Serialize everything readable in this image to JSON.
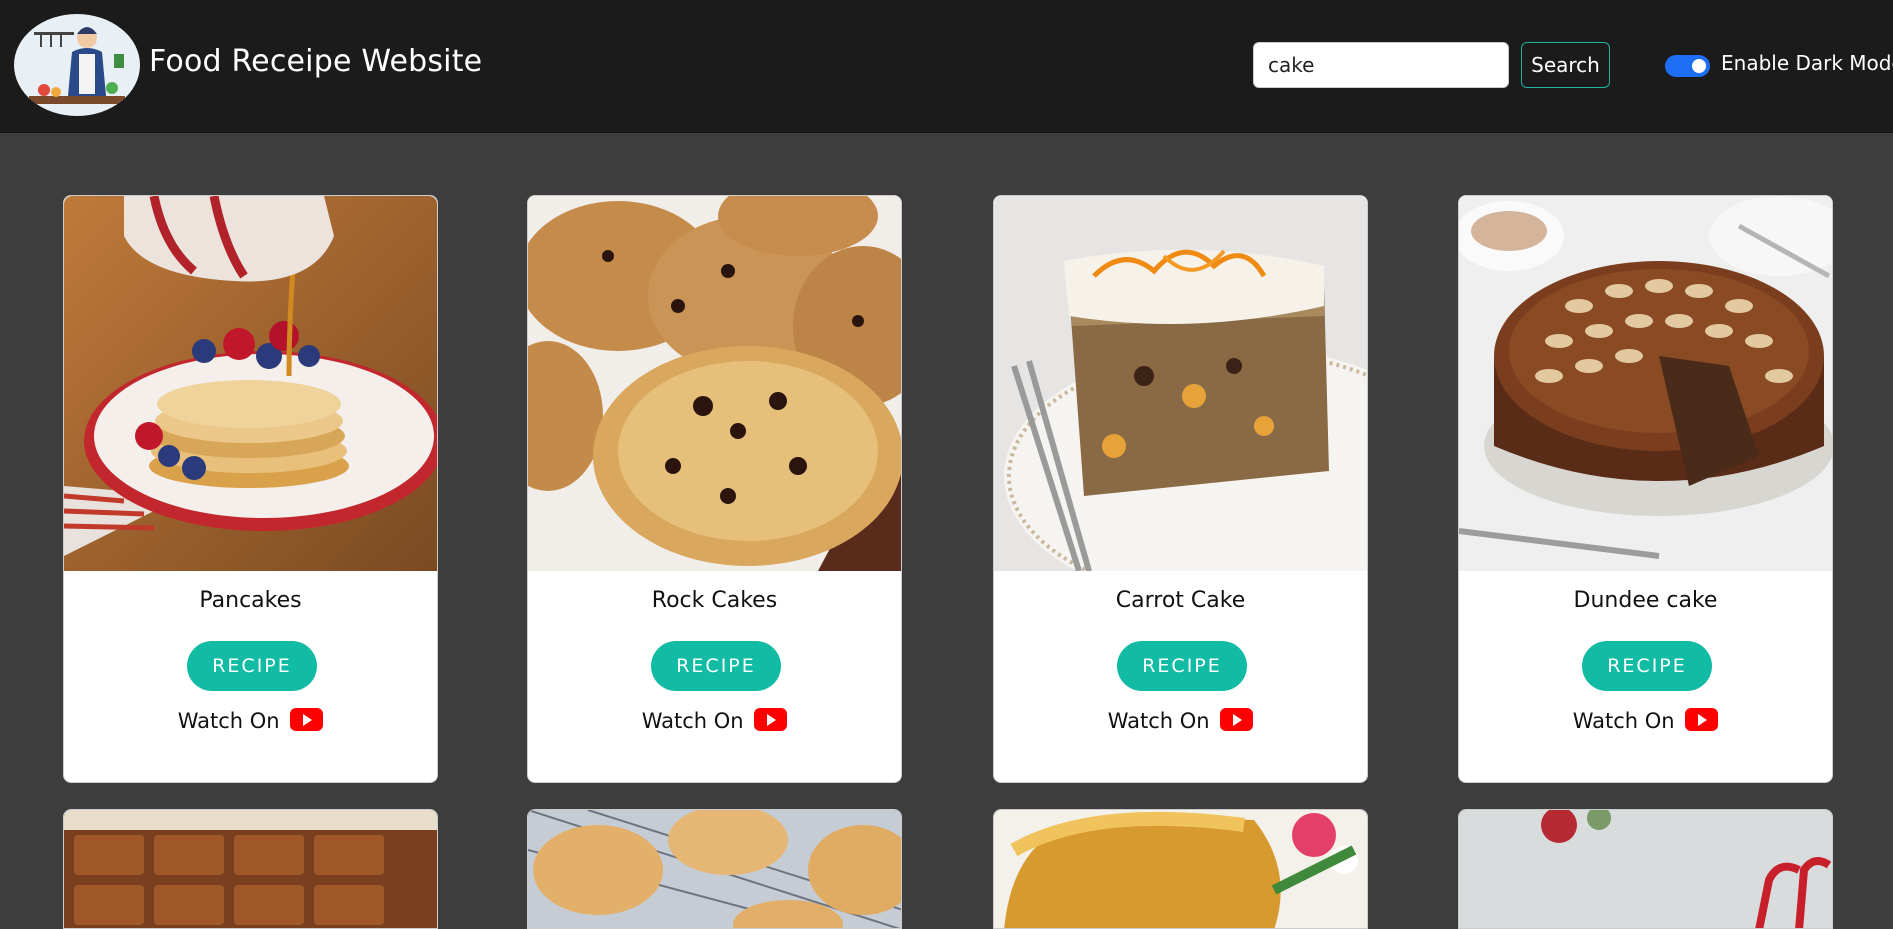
{
  "header": {
    "brand": "Food Receipe Website",
    "search": {
      "value": "cake",
      "button_label": "Search"
    },
    "dark_mode": {
      "label": "Enable Dark Mode",
      "enabled": true
    }
  },
  "cards": [
    {
      "title": "Pancakes",
      "button_label": "RECIPE",
      "watch_label": "Watch On"
    },
    {
      "title": "Rock Cakes",
      "button_label": "RECIPE",
      "watch_label": "Watch On"
    },
    {
      "title": "Carrot Cake",
      "button_label": "RECIPE",
      "watch_label": "Watch On"
    },
    {
      "title": "Dundee cake",
      "button_label": "RECIPE",
      "watch_label": "Watch On"
    }
  ],
  "icons": {
    "watch": "youtube-icon",
    "logo": "chef-logo-icon"
  },
  "colors": {
    "accent": "#12bba3",
    "navbar": "#1b1b1b",
    "background": "#3d3d3d",
    "toggle": "#1d6ef2",
    "youtube": "#ff0000"
  }
}
